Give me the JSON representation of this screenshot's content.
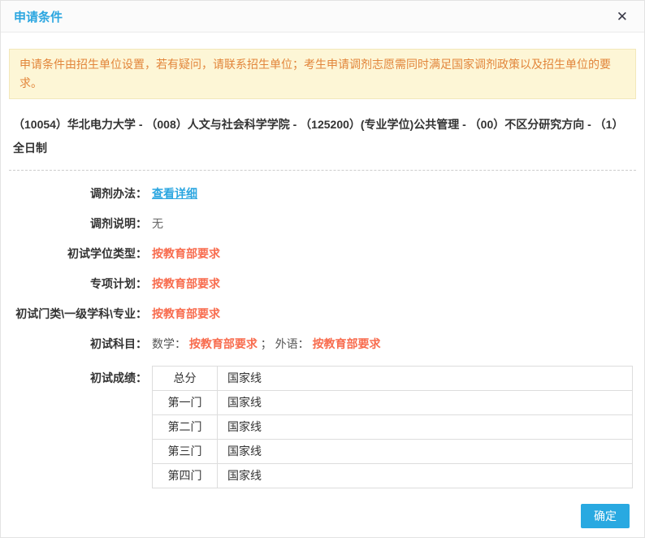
{
  "dialog": {
    "title": "申请条件",
    "close_icon": "✕"
  },
  "notice": {
    "text": "申请条件由招生单位设置，若有疑问，请联系招生单位；考生申请调剂志愿需同时满足国家调剂政策以及招生单位的要求。"
  },
  "program_info": "（10054）华北电力大学 - （008）人文与社会科学学院 - （125200）(专业学位)公共管理 - （00）不区分研究方向 - （1）全日制",
  "fields": {
    "method": {
      "label": "调剂办法：",
      "link": "查看详细"
    },
    "note": {
      "label": "调剂说明：",
      "value": "无"
    },
    "degree_type": {
      "label": "初试学位类型：",
      "value": "按教育部要求"
    },
    "special_plan": {
      "label": "专项计划：",
      "value": "按教育部要求"
    },
    "discipline": {
      "label": "初试门类\\一级学科\\专业：",
      "value": "按教育部要求"
    },
    "subjects": {
      "label": "初试科目：",
      "math_label": "数学：",
      "math_value": "按教育部要求",
      "separator": "；",
      "foreign_label": "外语：",
      "foreign_value": "按教育部要求"
    },
    "scores": {
      "label": "初试成绩："
    }
  },
  "score_table": {
    "rows": [
      {
        "name": "总分",
        "value": "国家线"
      },
      {
        "name": "第一门",
        "value": "国家线"
      },
      {
        "name": "第二门",
        "value": "国家线"
      },
      {
        "name": "第三门",
        "value": "国家线"
      },
      {
        "name": "第四门",
        "value": "国家线"
      }
    ]
  },
  "footer": {
    "confirm_label": "确定"
  },
  "colors": {
    "accent_blue": "#2ba6e0",
    "value_orange": "#f86c4e",
    "notice_text": "#e2853a",
    "notice_bg": "#fdf6d6",
    "button_blue": "#29a9e1"
  }
}
